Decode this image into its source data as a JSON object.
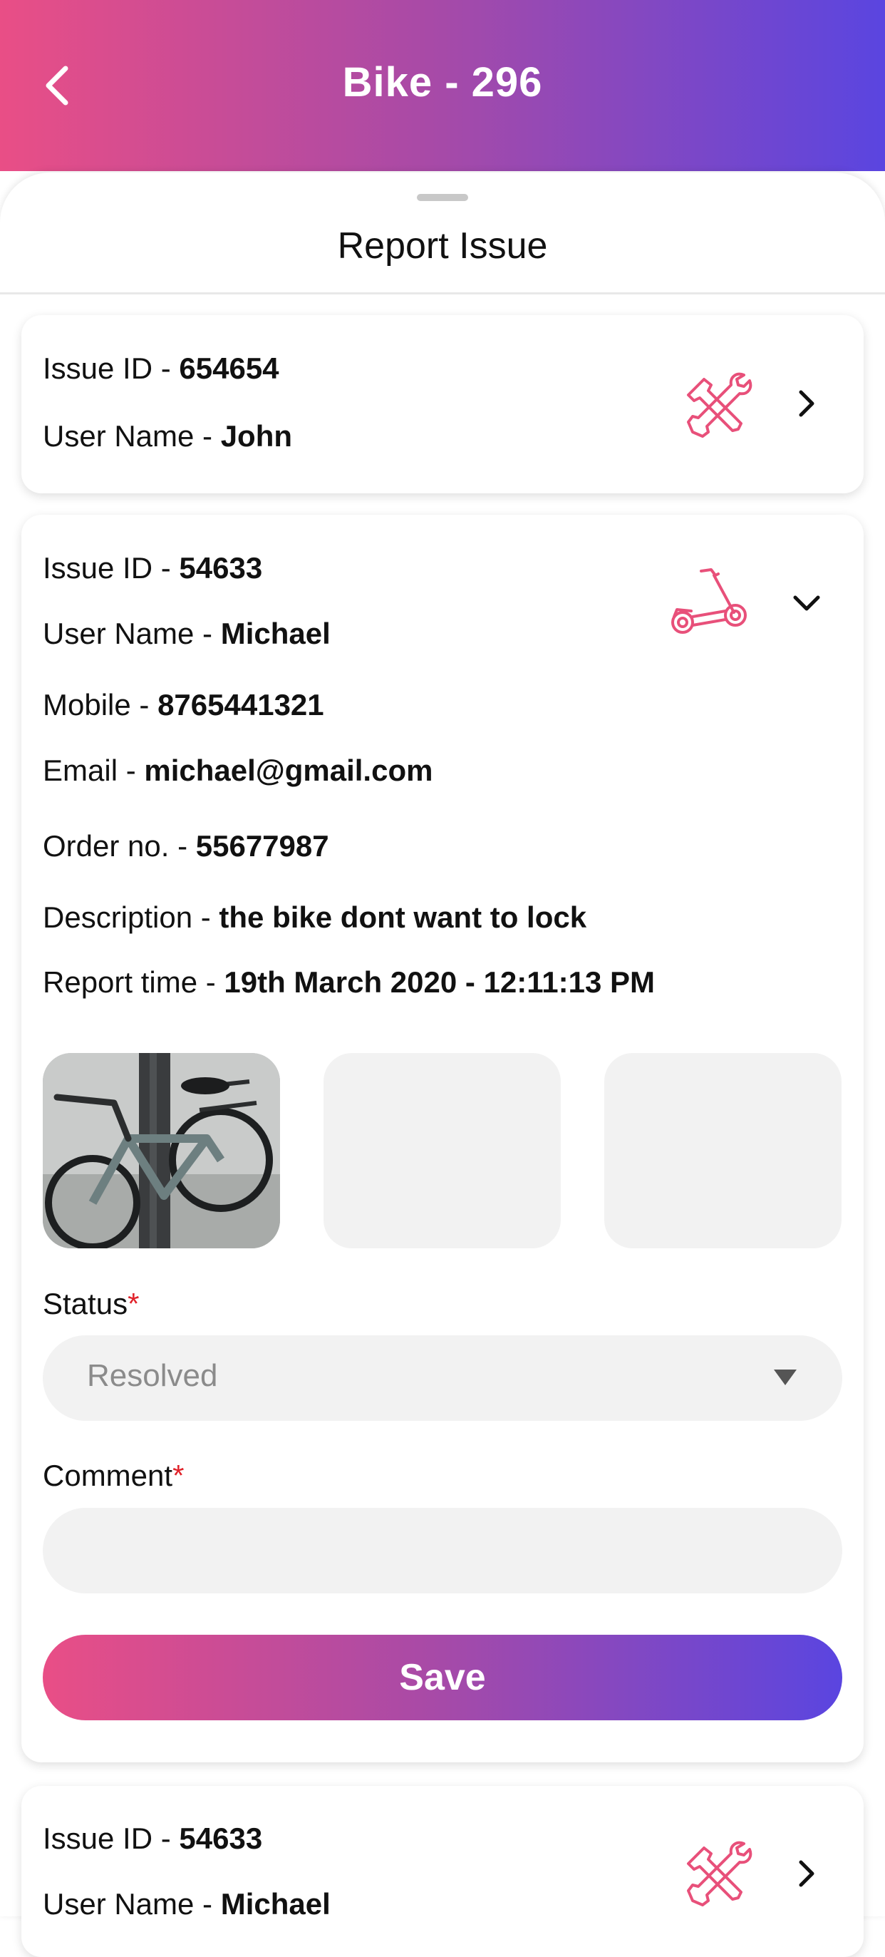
{
  "header": {
    "title": "Bike - 296",
    "back_icon": "chevron-left-icon"
  },
  "sheet": {
    "title": "Report Issue"
  },
  "issues": [
    {
      "id_label": "Issue ID - ",
      "id_value": "654654",
      "user_label": "User Name - ",
      "user_value": "John",
      "type_icon": "repair-tools-icon",
      "chevron_icon": "chevron-right-icon"
    },
    {
      "id_label": "Issue ID - ",
      "id_value": "54633",
      "user_label": "User Name - ",
      "user_value": "Michael",
      "mobile_label": "Mobile - ",
      "mobile_value": "8765441321",
      "email_label": "Email - ",
      "email_value": "michael@gmail.com",
      "order_label": "Order no. - ",
      "order_value": "55677987",
      "description_label": "Description - ",
      "description_value": "the bike dont want to lock",
      "report_time_label": "Report time - ",
      "report_time_value": "19th March 2020 - 12:11:13 PM",
      "type_icon": "scooter-icon",
      "chevron_icon": "chevron-down-icon",
      "photos": [
        "bike-photo",
        "empty-photo-slot",
        "empty-photo-slot"
      ],
      "status_label": "Status",
      "status_value": "Resolved",
      "comment_label": "Comment",
      "comment_value": "",
      "required_mark": "*",
      "save_label": "Save"
    },
    {
      "id_label": "Issue ID - ",
      "id_value": "54633",
      "user_label": "User Name - ",
      "user_value": "Michael",
      "type_icon": "repair-tools-icon",
      "chevron_icon": "chevron-right-icon"
    }
  ],
  "colors": {
    "accent_pink": "#e94e86",
    "accent_purple": "#5a45e0",
    "icon_pink": "#e8507a",
    "required": "#e0222a"
  }
}
